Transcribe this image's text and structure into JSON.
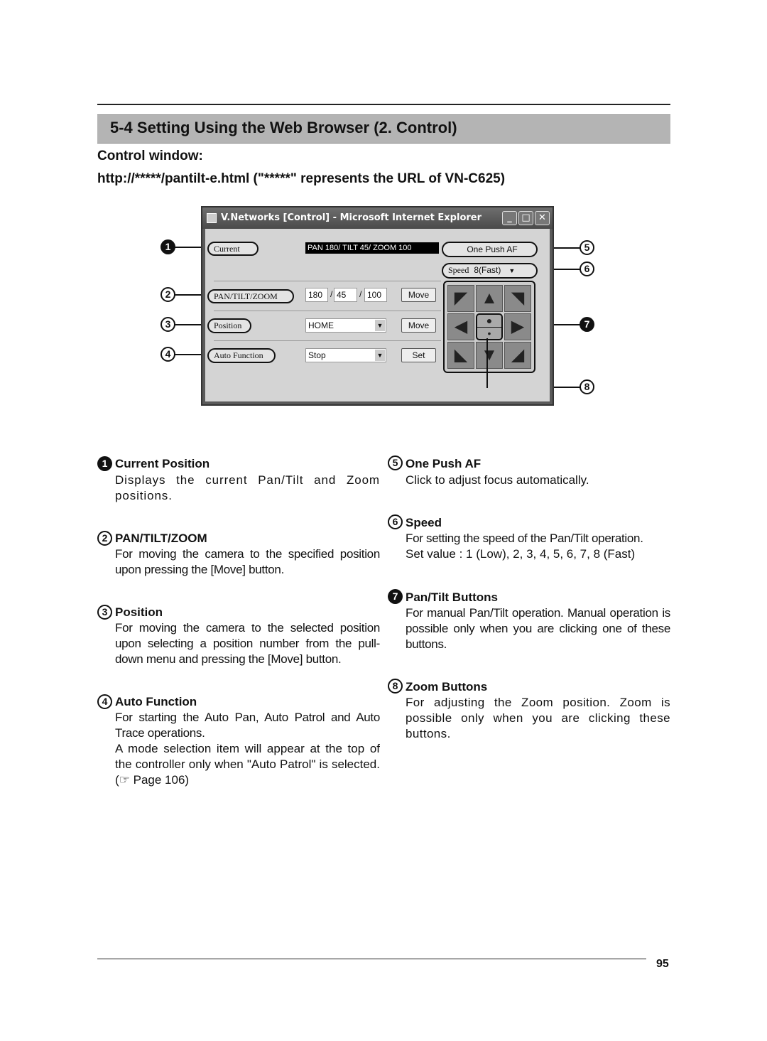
{
  "section": {
    "title": "5-4 Setting Using the Web Browser (2. Control)",
    "subtitle": "Control window:",
    "url_line": "http://*****/pantilt-e.html (\"*****\" represents the URL of VN-C625)"
  },
  "window": {
    "title": "V.Networks [Control] - Microsoft Internet Explorer",
    "current_label": "Current",
    "current_value": "PAN 180/ TILT 45/ ZOOM 100",
    "one_push_af": "One Push AF",
    "speed_label": "Speed",
    "speed_value": "8(Fast)",
    "ptz_label": "PAN/TILT/ZOOM",
    "pan": "180",
    "tilt": "45",
    "zoom": "100",
    "slash": "/",
    "move": "Move",
    "position_label": "Position",
    "position_value": "HOME",
    "auto_label": "Auto Function",
    "auto_value": "Stop",
    "set": "Set",
    "controls": {
      "minimize": "_",
      "maximize": "□",
      "close": "✕"
    }
  },
  "callouts": [
    "1",
    "2",
    "3",
    "4",
    "5",
    "6",
    "7",
    "8"
  ],
  "items": [
    {
      "n": "1",
      "title": "Current Position",
      "text": "Displays the current Pan/Tilt and Zoom positions."
    },
    {
      "n": "2",
      "title": "PAN/TILT/ZOOM",
      "text": "For moving the camera to the specified position upon pressing the [Move] button."
    },
    {
      "n": "3",
      "title": "Position",
      "text": "For moving the camera to the selected position upon selecting a position number from the pull-down menu and pressing the [Move] button."
    },
    {
      "n": "4",
      "title": "Auto Function",
      "text": "For starting the Auto Pan, Auto Patrol and Auto Trace operations.",
      "text2": "A mode selection item will appear at the top of the controller only when \"Auto Patrol\" is selected. (☞ Page 106)"
    },
    {
      "n": "5",
      "title": "One Push AF",
      "text": "Click to adjust focus automatically."
    },
    {
      "n": "6",
      "title": "Speed",
      "text": "For setting the speed of the Pan/Tilt operation.",
      "text2": "Set value : 1 (Low), 2, 3, 4, 5, 6, 7, 8 (Fast)"
    },
    {
      "n": "7",
      "title": "Pan/Tilt Buttons",
      "text": "For manual Pan/Tilt operation. Manual operation is possible only when you are clicking one of these buttons."
    },
    {
      "n": "8",
      "title": "Zoom Buttons",
      "text": "For adjusting the Zoom position. Zoom is possible only when you are clicking these buttons."
    }
  ],
  "page_number": "95"
}
